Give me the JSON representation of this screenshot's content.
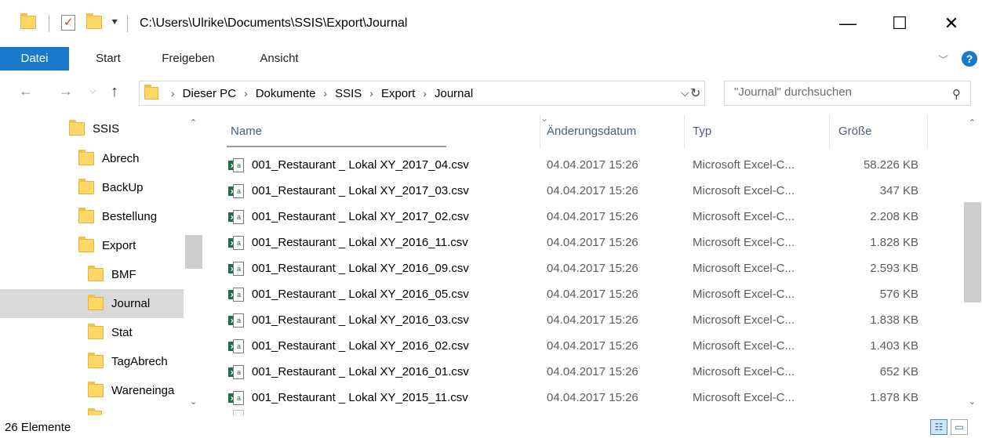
{
  "window": {
    "title": "C:\\Users\\Ulrike\\Documents\\SSIS\\Export\\Journal",
    "minimize": "—",
    "maximize": "☐",
    "close": "✕"
  },
  "ribbon": {
    "tabs": [
      "Datei",
      "Start",
      "Freigeben",
      "Ansicht"
    ],
    "expand_icon": "chevron-down-icon",
    "help_icon": "help-icon",
    "accent": "#1979ca"
  },
  "address": {
    "crumbs": [
      "Dieser PC",
      "Dokumente",
      "SSIS",
      "Export",
      "Journal"
    ],
    "search_placeholder": "\"Journal\" durchsuchen"
  },
  "nav": {
    "items": [
      {
        "label": "SSIS",
        "level": 0,
        "selected": false
      },
      {
        "label": "Abrech",
        "level": 1,
        "selected": false
      },
      {
        "label": "BackUp",
        "level": 1,
        "selected": false
      },
      {
        "label": "Bestellung",
        "level": 1,
        "selected": false
      },
      {
        "label": "Export",
        "level": 1,
        "selected": false
      },
      {
        "label": "BMF",
        "level": 2,
        "selected": false
      },
      {
        "label": "Journal",
        "level": 2,
        "selected": true
      },
      {
        "label": "Stat",
        "level": 2,
        "selected": false
      },
      {
        "label": "TagAbrech",
        "level": 2,
        "selected": false
      },
      {
        "label": "Wareneinga",
        "level": 2,
        "selected": false
      }
    ]
  },
  "columns": {
    "name": "Name",
    "date": "Änderungsdatum",
    "type": "Typ",
    "size": "Größe"
  },
  "files": [
    {
      "name": "001_Restaurant _ Lokal XY_2017_04.csv",
      "date": "04.04.2017 15:26",
      "type": "Microsoft Excel-C...",
      "size": "58.226 KB"
    },
    {
      "name": "001_Restaurant _ Lokal XY_2017_03.csv",
      "date": "04.04.2017 15:26",
      "type": "Microsoft Excel-C...",
      "size": "347 KB"
    },
    {
      "name": "001_Restaurant _ Lokal XY_2017_02.csv",
      "date": "04.04.2017 15:26",
      "type": "Microsoft Excel-C...",
      "size": "2.208 KB"
    },
    {
      "name": "001_Restaurant _ Lokal XY_2016_11.csv",
      "date": "04.04.2017 15:26",
      "type": "Microsoft Excel-C...",
      "size": "1.828 KB"
    },
    {
      "name": "001_Restaurant _ Lokal XY_2016_09.csv",
      "date": "04.04.2017 15:26",
      "type": "Microsoft Excel-C...",
      "size": "2.593 KB"
    },
    {
      "name": "001_Restaurant _ Lokal XY_2016_05.csv",
      "date": "04.04.2017 15:26",
      "type": "Microsoft Excel-C...",
      "size": "576 KB"
    },
    {
      "name": "001_Restaurant _ Lokal XY_2016_03.csv",
      "date": "04.04.2017 15:26",
      "type": "Microsoft Excel-C...",
      "size": "1.838 KB"
    },
    {
      "name": "001_Restaurant _ Lokal XY_2016_02.csv",
      "date": "04.04.2017 15:26",
      "type": "Microsoft Excel-C...",
      "size": "1.403 KB"
    },
    {
      "name": "001_Restaurant _ Lokal XY_2016_01.csv",
      "date": "04.04.2017 15:26",
      "type": "Microsoft Excel-C...",
      "size": "652 KB"
    },
    {
      "name": "001_Restaurant _ Lokal XY_2015_11.csv",
      "date": "04.04.2017 15:26",
      "type": "Microsoft Excel-C...",
      "size": "1.878 KB"
    }
  ],
  "status": {
    "count_text": "26 Elemente"
  }
}
